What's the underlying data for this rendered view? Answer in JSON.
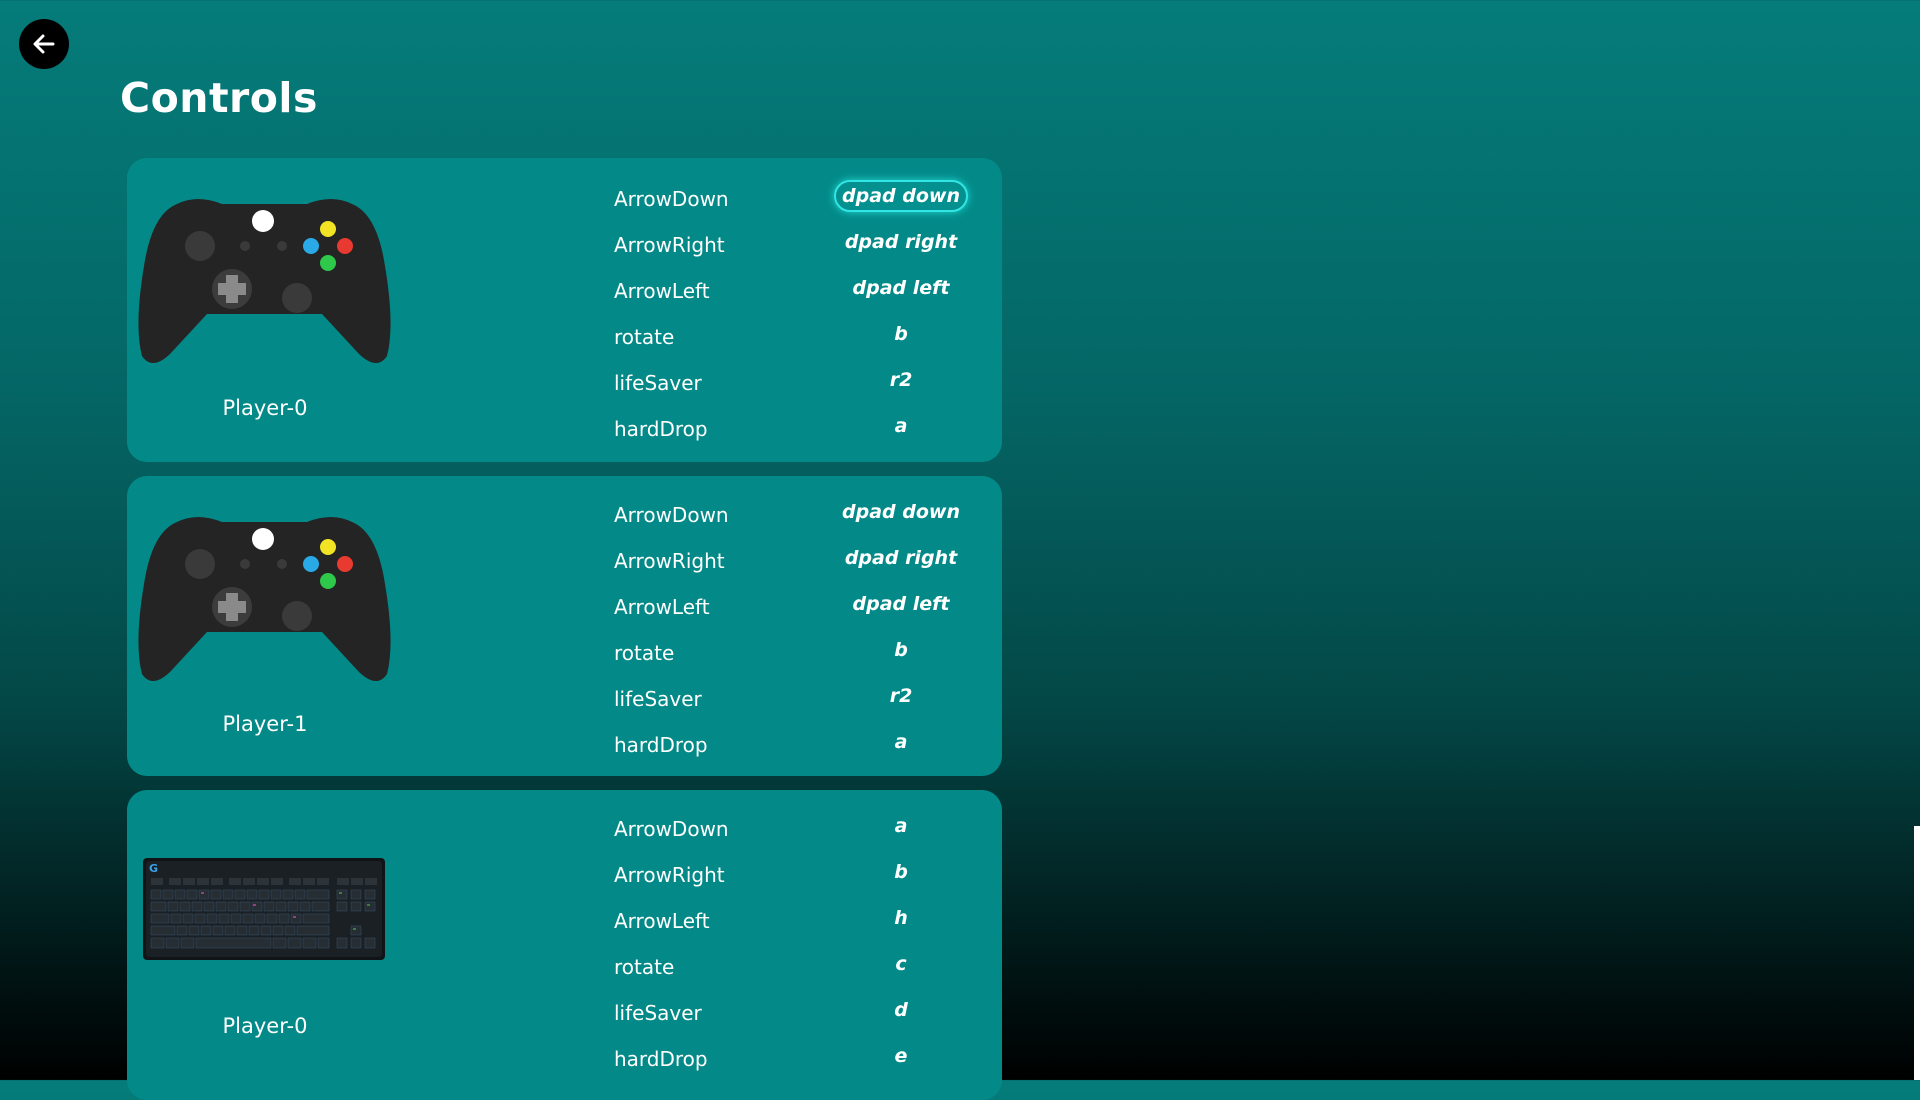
{
  "page": {
    "title": "Controls"
  },
  "colors": {
    "accent": "#33e5e2",
    "card": "#038a88",
    "text": "#ffffff"
  },
  "back_button": {
    "icon": "arrow-left-icon"
  },
  "players": [
    {
      "device": "gamepad",
      "name": "Player-0",
      "bindings": [
        {
          "action": "ArrowDown",
          "key": "dpad down",
          "selected": true
        },
        {
          "action": "ArrowRight",
          "key": "dpad right"
        },
        {
          "action": "ArrowLeft",
          "key": "dpad left"
        },
        {
          "action": "rotate",
          "key": "b"
        },
        {
          "action": "lifeSaver",
          "key": "r2"
        },
        {
          "action": "hardDrop",
          "key": "a"
        }
      ]
    },
    {
      "device": "gamepad",
      "name": "Player-1",
      "bindings": [
        {
          "action": "ArrowDown",
          "key": "dpad down"
        },
        {
          "action": "ArrowRight",
          "key": "dpad right"
        },
        {
          "action": "ArrowLeft",
          "key": "dpad left"
        },
        {
          "action": "rotate",
          "key": "b"
        },
        {
          "action": "lifeSaver",
          "key": "r2"
        },
        {
          "action": "hardDrop",
          "key": "a"
        }
      ]
    },
    {
      "device": "keyboard",
      "name": "Player-0",
      "bindings": [
        {
          "action": "ArrowDown",
          "key": "a"
        },
        {
          "action": "ArrowRight",
          "key": "b"
        },
        {
          "action": "ArrowLeft",
          "key": "h"
        },
        {
          "action": "rotate",
          "key": "c"
        },
        {
          "action": "lifeSaver",
          "key": "d"
        },
        {
          "action": "hardDrop",
          "key": "e"
        }
      ]
    }
  ]
}
